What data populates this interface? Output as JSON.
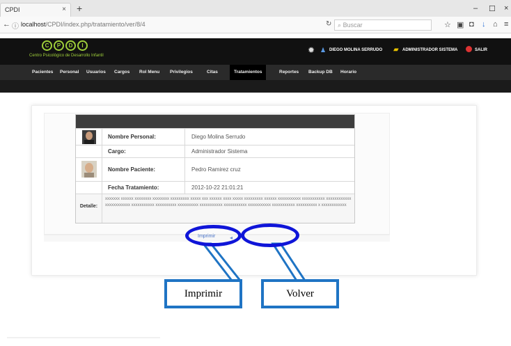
{
  "browser": {
    "tab_title": "CPDI",
    "tab_close": "×",
    "new_tab": "+",
    "url_host": "localhost",
    "url_path": "/CPDI/index.php/tratamiento/ver/8/4",
    "search_placeholder": "Buscar",
    "window_controls": [
      "–",
      "☐",
      "×"
    ]
  },
  "app": {
    "logo_letters": [
      "C",
      "P",
      "D",
      "I"
    ],
    "logo_subtitle": "Centro Psicológico de Desarrollo Infantil",
    "user_name": "DIEGO MOLINA SERRUDO",
    "role": "ADMINISTRADOR SISTEMA",
    "logout": "SALIR"
  },
  "menu": {
    "items": [
      "Pacientes",
      "Personal",
      "Usuarios",
      "Cargos",
      "Rol Menu",
      "Privilegios",
      "Citas",
      "Tratamientos",
      "Reportes",
      "Backup DB",
      "Horario"
    ],
    "active": "Tratamientos"
  },
  "record": {
    "rows": [
      {
        "label": "Nombre Personal:",
        "value": "Diego Molina Serrudo"
      },
      {
        "label": "Cargo:",
        "value": "Administrador Sistema"
      },
      {
        "label": "Nombre Paciente:",
        "value": "Pedro Ramirez cruz"
      },
      {
        "label": "Fecha Tratamiento:",
        "value": "2012-10-22 21:01:21"
      }
    ],
    "detail_label": "Detalle:",
    "detail_text": "xxxxxxx xxxxxx xxxxxxxx xxxxxxxx xxxxxxxxx xxxxx xxx xxxxxx xxxx xxxxx xxxxxxxxx xxxxxx xxxxxxxxxxx xxxxxxxxxxx xxxxxxxxxxxx xxxxxxxxxxxx xxxxxxxxxxx xxxxxxxxxx xxxxxxxxxx xxxxxxxxxxx xxxxxxxxxxx xxxxxxxxxxx xxxxxxxxxxx xxxxxxxxxx x xxxxxxxxxxxx"
  },
  "actions": {
    "print_link": "Imprimir",
    "back_link": "Volver"
  },
  "callouts": {
    "print": "Imprimir",
    "back": "Volver"
  },
  "colors": {
    "callout_ellipse": "#0f15d8",
    "callout_box": "#1f74c4",
    "logo_green": "#9fcf3a"
  }
}
